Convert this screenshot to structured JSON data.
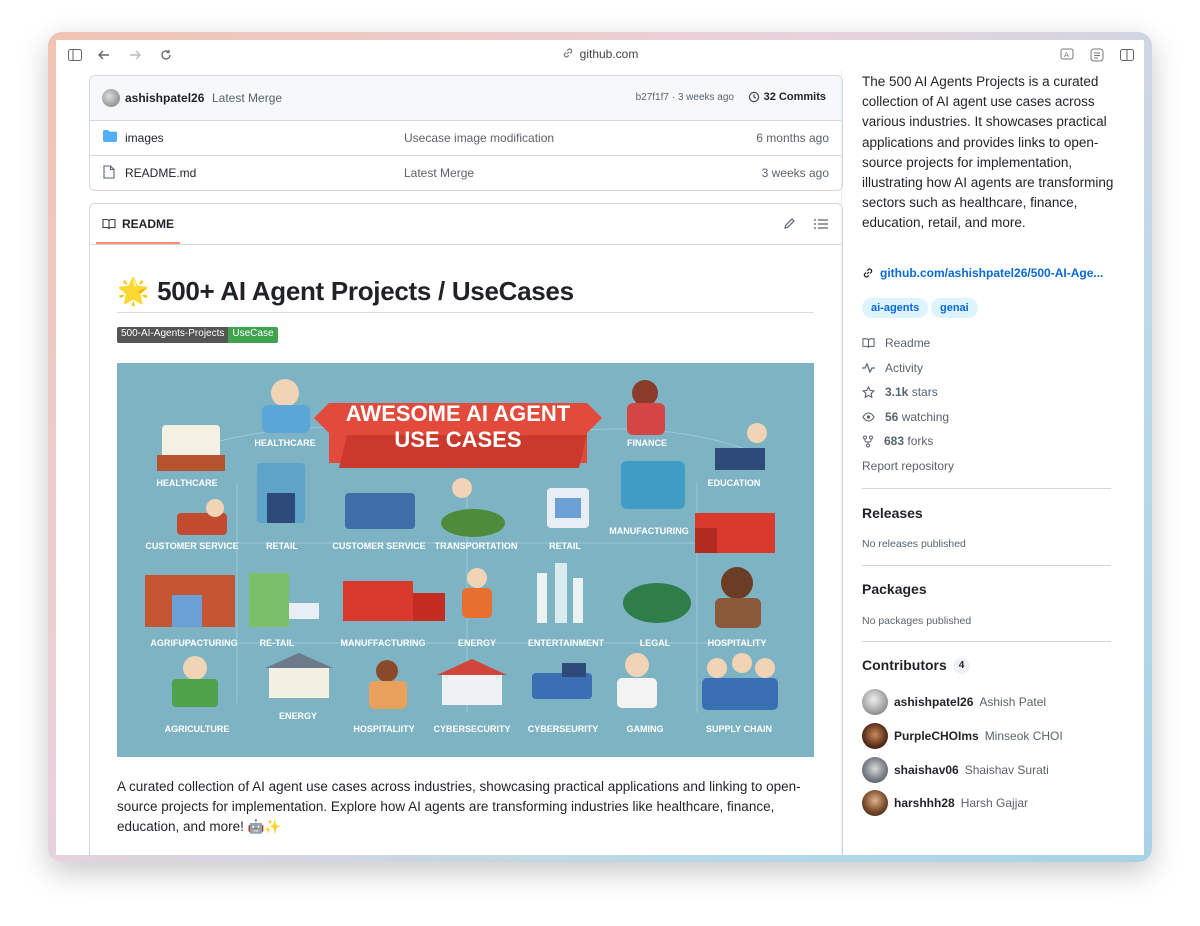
{
  "browser": {
    "url": "github.com"
  },
  "commit": {
    "user": "ashishpatel26",
    "message": "Latest Merge",
    "sha_time": "b27f1f7 · 3 weeks ago",
    "commits_label": "32 Commits"
  },
  "files": [
    {
      "name": "images",
      "type": "folder",
      "message": "Usecase image modification",
      "date": "6 months ago"
    },
    {
      "name": "README.md",
      "type": "file",
      "message": "Latest Merge",
      "date": "3 weeks ago"
    }
  ],
  "readme": {
    "tab_label": "README",
    "title": "500+ AI Agent Projects / UseCases",
    "title_icon": "🌟",
    "badge_left": "500-AI-Agents-Projects",
    "badge_right": "UseCase",
    "hero": {
      "banner_line1": "AWESOME AI AGENT",
      "banner_line2": "USE CASES",
      "labels": [
        "HEALTHCARE",
        "HEALTHCARE",
        "FINANCE",
        "EDUCATION",
        "CUSTOMER SERVICE",
        "RETAIL",
        "CUSTOMER SERVICE",
        "TRANSPORTATION",
        "RETAIL",
        "MANUFACTURING",
        "AGRIFUPACTURING",
        "RE-TAIL",
        "MANUFFACTURING",
        "ENERGY",
        "ENTERTAINMENT",
        "LEGAL",
        "HOSPITALITY",
        "AGRICULTURE",
        "ENERGY",
        "HOSPITALIITY",
        "CYBERSECURITY",
        "CYBERSEURITY",
        "GAMING",
        "SUPPLY CHAIN"
      ]
    },
    "description": "A curated collection of AI agent use cases across industries, showcasing practical applications and linking to open-source projects for implementation. Explore how AI agents are transforming industries like healthcare, finance, education, and more! 🤖✨"
  },
  "sidebar": {
    "about": "The 500 AI Agents Projects is a curated collection of AI agent use cases across various industries. It showcases practical applications and provides links to open-source projects for implementation, illustrating how AI agents are transforming sectors such as healthcare, finance, education, retail, and more.",
    "link": "github.com/ashishpatel26/500-AI-Age...",
    "topics": [
      "ai-agents",
      "genai"
    ],
    "readme_label": "Readme",
    "activity_label": "Activity",
    "stars_count": "3.1k",
    "stars_label": "stars",
    "watching_count": "56",
    "watching_label": "watching",
    "forks_count": "683",
    "forks_label": "forks",
    "report_label": "Report repository",
    "releases_title": "Releases",
    "releases_sub": "No releases published",
    "packages_title": "Packages",
    "packages_sub": "No packages published",
    "contributors_title": "Contributors",
    "contributors_count": "4",
    "contributors": [
      {
        "login": "ashishpatel26",
        "name": "Ashish Patel"
      },
      {
        "login": "PurpleCHOIms",
        "name": "Minseok CHOI"
      },
      {
        "login": "shaishav06",
        "name": "Shaishav Surati"
      },
      {
        "login": "harshhh28",
        "name": "Harsh Gajjar"
      }
    ]
  }
}
